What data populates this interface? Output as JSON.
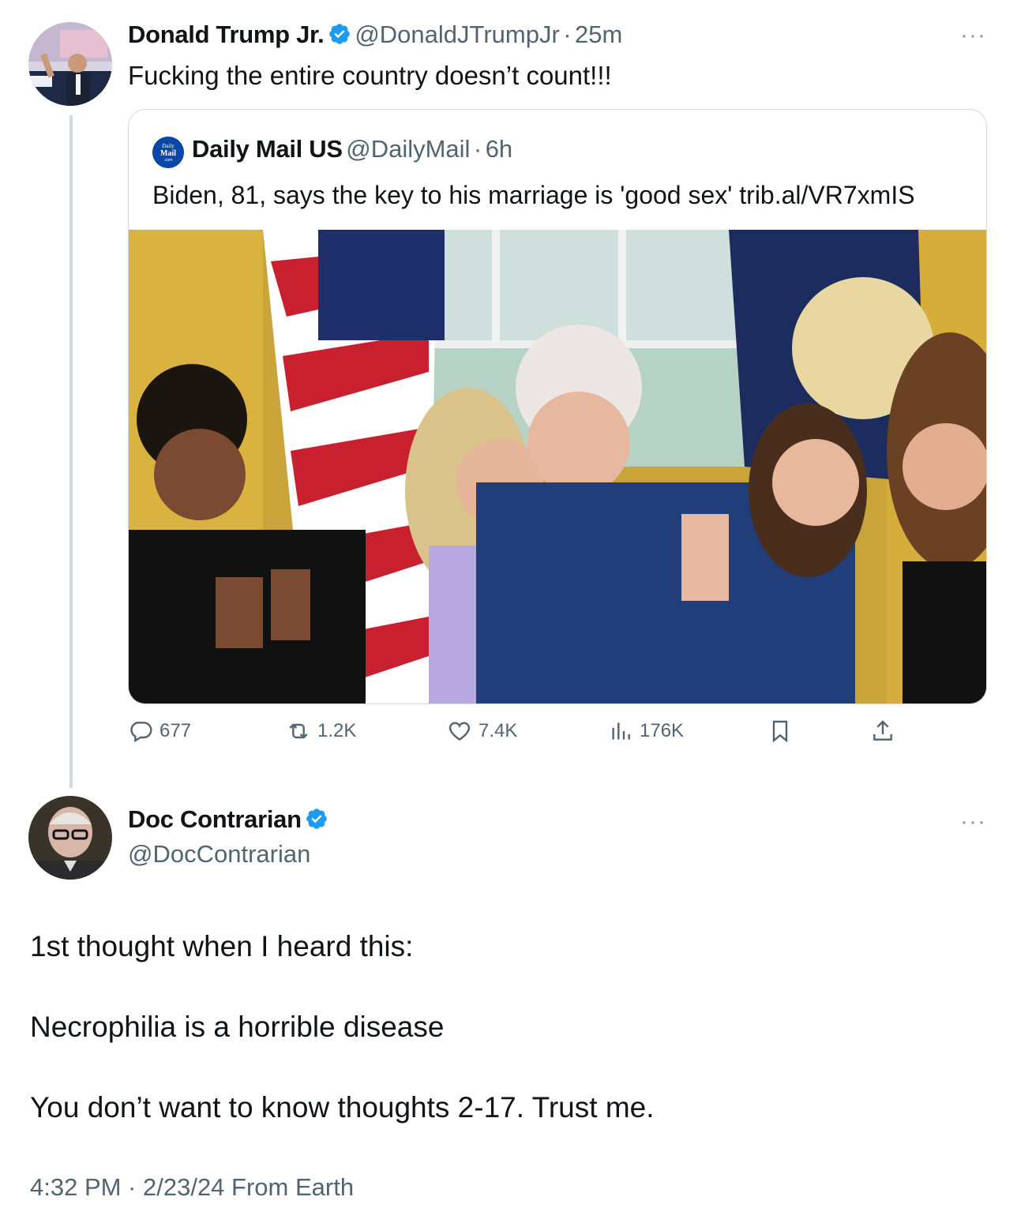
{
  "main_tweet": {
    "author_name": "Donald Trump Jr.",
    "handle": "@DonaldJTrumpJr",
    "time": "25m",
    "text": "Fucking the entire country doesn’t count!!!",
    "more_label": "···"
  },
  "quoted_tweet": {
    "author_name": "Daily Mail US",
    "handle": "@DailyMail",
    "time": "6h",
    "text": "Biden, 81, says the key to his marriage is 'good sex' trib.al/VR7xmIS",
    "logo_text": "Daily Mail .com"
  },
  "actions": {
    "replies": "677",
    "retweets": "1.2K",
    "likes": "7.4K",
    "views": "176K"
  },
  "reply_tweet": {
    "author_name": "Doc Contrarian",
    "handle": "@DocContrarian",
    "line1": "1st thought when I heard this:",
    "line2": "Necrophilia is a horrible disease",
    "line3": "You don’t want to know thoughts 2-17. Trust me.",
    "timestamp": "4:32 PM · 2/23/24 From Earth",
    "more_label": "···"
  },
  "colors": {
    "verified": "#1d9bf0",
    "muted": "#536471",
    "border": "#cfd9de"
  }
}
